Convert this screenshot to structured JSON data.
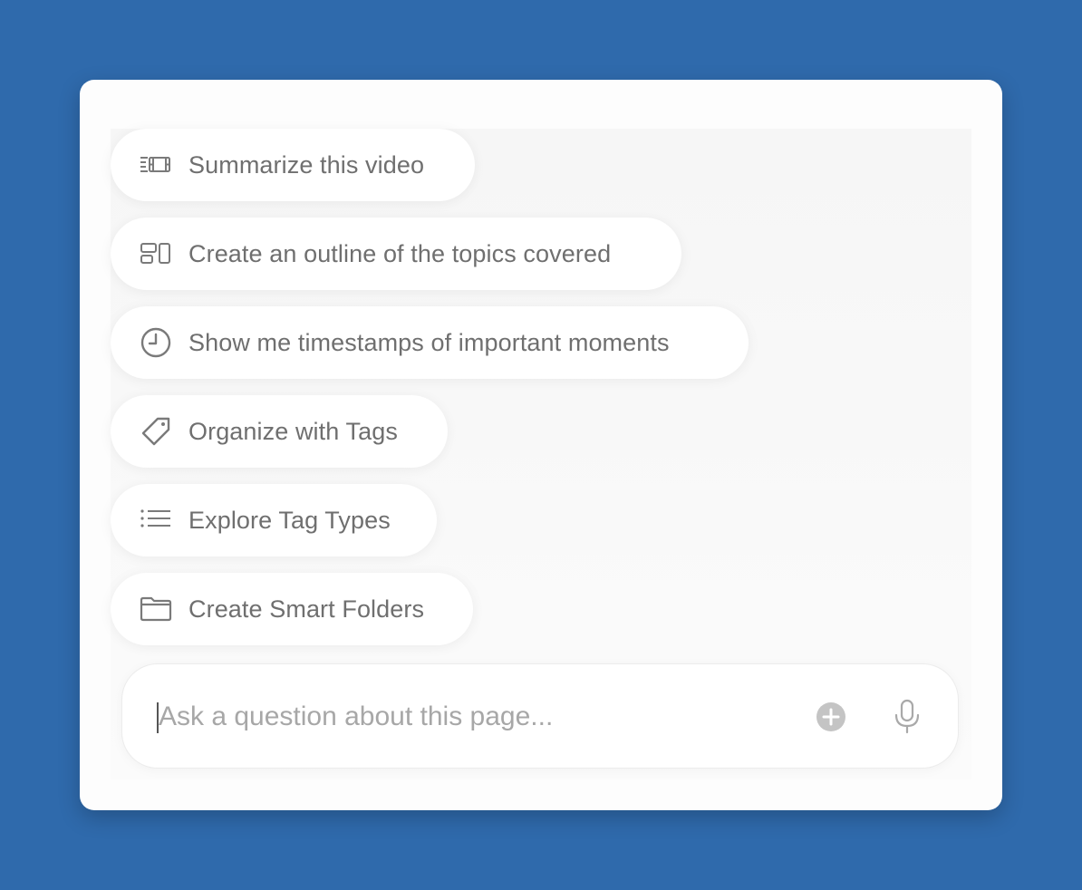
{
  "suggestions": [
    {
      "label": "Summarize this video",
      "icon": "video-summary-icon"
    },
    {
      "label": "Create an outline of the topics covered",
      "icon": "outline-layout-icon"
    },
    {
      "label": "Show me timestamps of important moments",
      "icon": "clock-icon"
    },
    {
      "label": "Organize with Tags",
      "icon": "tag-icon"
    },
    {
      "label": "Explore Tag Types",
      "icon": "list-icon"
    },
    {
      "label": "Create Smart Folders",
      "icon": "folder-icon"
    }
  ],
  "input": {
    "placeholder": "Ask a question about this page...",
    "value": ""
  },
  "colors": {
    "background": "#2f6aac",
    "card": "#fdfdfd",
    "text": "#6f6f6f",
    "placeholder": "#a7a7a7",
    "icon": "#7a7a7a",
    "add_button": "#c4c4c4"
  }
}
